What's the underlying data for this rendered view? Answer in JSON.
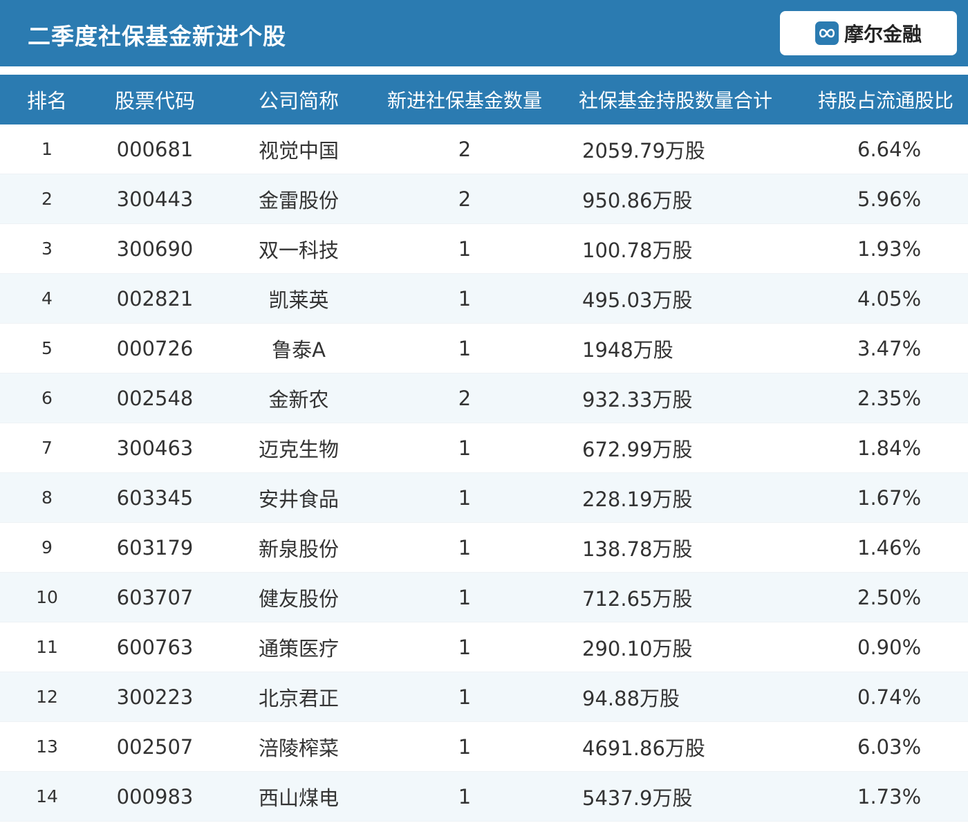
{
  "header": {
    "title": "二季度社保基金新进个股",
    "logo_text": "摩尔金融",
    "logo_icon": "infinity-icon",
    "bg_color": "#2b7bb1"
  },
  "table": {
    "columns": [
      "排名",
      "股票代码",
      "公司简称",
      "新进社保基金数量",
      "社保基金持股数量合计",
      "持股占流通股比"
    ],
    "rows": [
      {
        "rank": "1",
        "code": "000681",
        "name": "视觉中国",
        "count": "2",
        "total": "2059.79万股",
        "ratio": "6.64%"
      },
      {
        "rank": "2",
        "code": "300443",
        "name": "金雷股份",
        "count": "2",
        "total": "950.86万股",
        "ratio": "5.96%"
      },
      {
        "rank": "3",
        "code": "300690",
        "name": "双一科技",
        "count": "1",
        "total": "100.78万股",
        "ratio": "1.93%"
      },
      {
        "rank": "4",
        "code": "002821",
        "name": "凯莱英",
        "count": "1",
        "total": "495.03万股",
        "ratio": "4.05%"
      },
      {
        "rank": "5",
        "code": "000726",
        "name": "鲁泰A",
        "count": "1",
        "total": "1948万股",
        "ratio": "3.47%"
      },
      {
        "rank": "6",
        "code": "002548",
        "name": "金新农",
        "count": "2",
        "total": "932.33万股",
        "ratio": "2.35%"
      },
      {
        "rank": "7",
        "code": "300463",
        "name": "迈克生物",
        "count": "1",
        "total": "672.99万股",
        "ratio": "1.84%"
      },
      {
        "rank": "8",
        "code": "603345",
        "name": "安井食品",
        "count": "1",
        "total": "228.19万股",
        "ratio": "1.67%"
      },
      {
        "rank": "9",
        "code": "603179",
        "name": "新泉股份",
        "count": "1",
        "total": "138.78万股",
        "ratio": "1.46%"
      },
      {
        "rank": "10",
        "code": "603707",
        "name": "健友股份",
        "count": "1",
        "total": "712.65万股",
        "ratio": "2.50%"
      },
      {
        "rank": "11",
        "code": "600763",
        "name": "通策医疗",
        "count": "1",
        "total": "290.10万股",
        "ratio": "0.90%"
      },
      {
        "rank": "12",
        "code": "300223",
        "name": "北京君正",
        "count": "1",
        "total": "94.88万股",
        "ratio": "0.74%"
      },
      {
        "rank": "13",
        "code": "002507",
        "name": "涪陵榨菜",
        "count": "1",
        "total": "4691.86万股",
        "ratio": "6.03%"
      },
      {
        "rank": "14",
        "code": "000983",
        "name": "西山煤电",
        "count": "1",
        "total": "5437.9万股",
        "ratio": "1.73%"
      }
    ]
  }
}
